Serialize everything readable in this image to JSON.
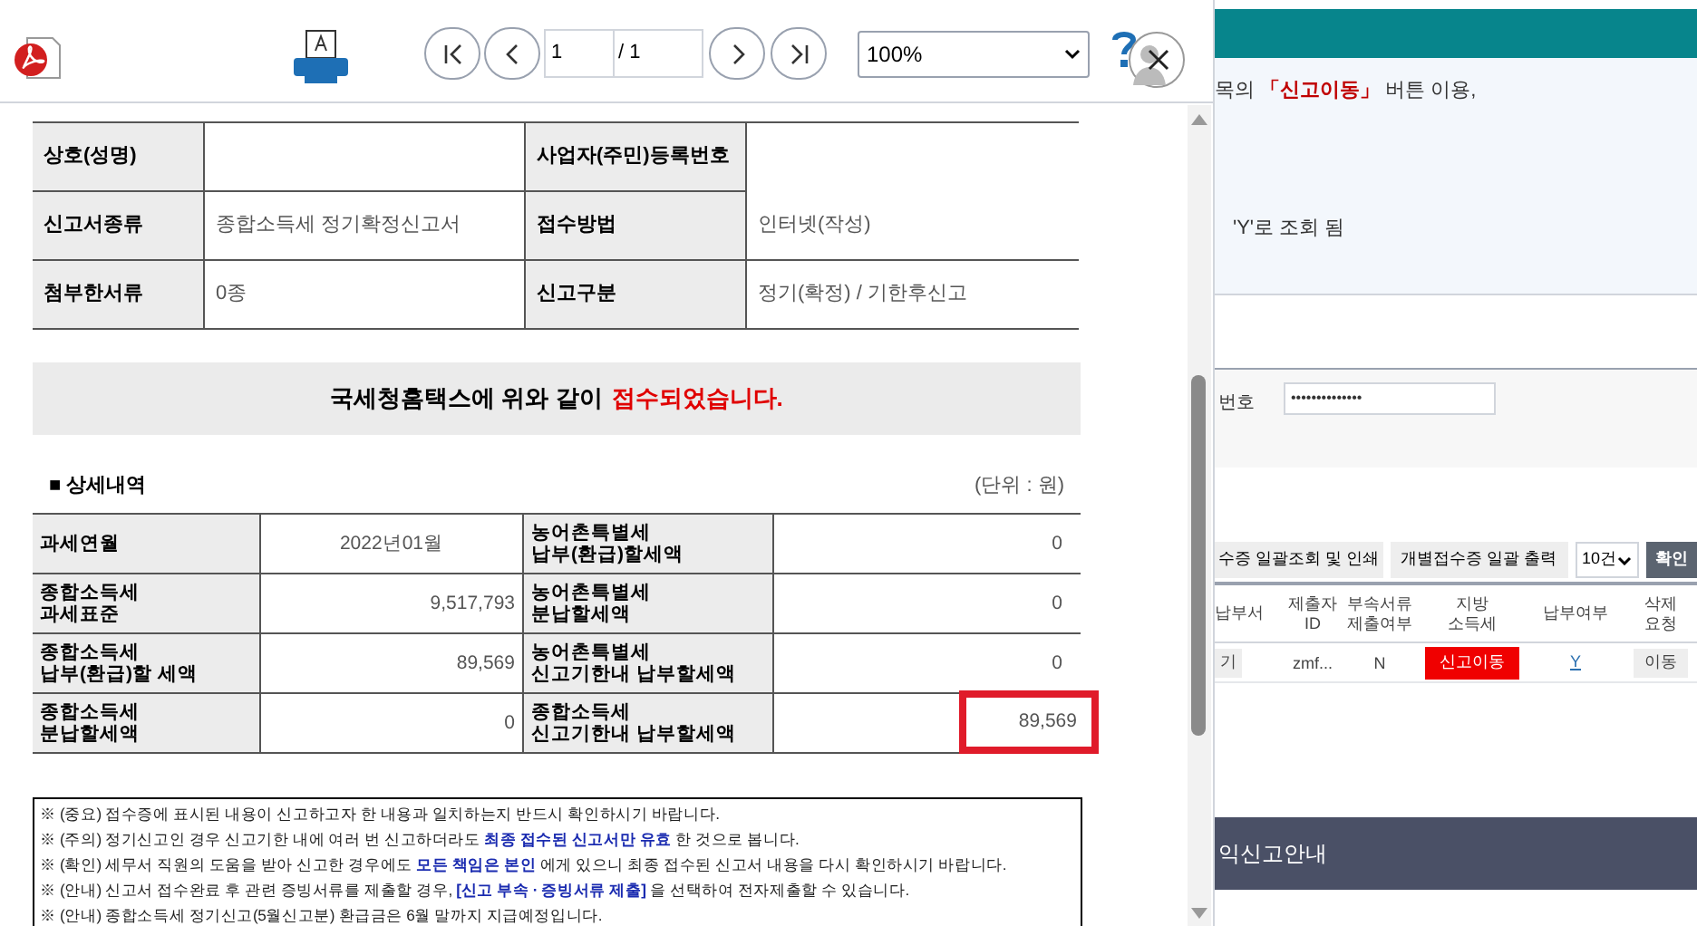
{
  "viewer": {
    "page": "1",
    "total": "/ 1",
    "zoom": "100%"
  },
  "summary": [
    {
      "label": "상호(성명)",
      "label2": "사업자(주민)등록번호"
    },
    {
      "label": "신고서종류",
      "value": "종합소득세 정기확정신고서",
      "label2": "접수방법",
      "value2": "인터넷(작성)"
    },
    {
      "label": "첨부한서류",
      "value": "0종",
      "label2": "신고구분",
      "value2": "정기(확정) / 기한후신고"
    }
  ],
  "banner": {
    "text": "국세청홈택스에 위와 같이",
    "highlight": "접수되었습니다."
  },
  "detail": {
    "title": "■ 상세내역",
    "unit": "(단위 : 원)",
    "rows": [
      {
        "label": "과세연월",
        "value": "2022년01월",
        "label2": "농어촌특별세\n납부(환급)할세액",
        "value2": "0",
        "highlighted": false
      },
      {
        "label": "종합소득세\n과세표준",
        "value": "9,517,793",
        "label2": "농어촌특별세\n분납할세액",
        "value2": "0",
        "highlighted": false
      },
      {
        "label": "종합소득세\n납부(환급)할 세액",
        "value": "89,569",
        "label2": "농어촌특별세\n신고기한내 납부할세액",
        "value2": "0",
        "highlighted": false
      },
      {
        "label": "종합소득세\n분납할세액",
        "value": "0",
        "label2": "종합소득세\n신고기한내 납부할세액",
        "value2": "89,569",
        "highlighted": true
      }
    ]
  },
  "notices": [
    "※ (중요) 접수증에 표시된 내용이 신고하고자 한 내용과 일치하는지 반드시 확인하시기 바랍니다.",
    "※ (주의) 정기신고인 경우 신고기한 내에 여러 번 신고하더라도  **최종 접수된 신고서만 유효** 한 것으로 봅니다.",
    "※ (확인) 세무서 직원의 도움을 받아 신고한 경우에도  **모든 책임은 본인** 에게 있으니 최종 접수된 신고서 내용을 다시 확인하시기 바랍니다.",
    "※ (안내) 신고서 접수완료 후 관련 증빙서류를 제출할 경우,  **[신고 부속 · 증빙서류 제출]** 을 선택하여 전자제출할 수 있습니다.",
    "※ (안내) 종합소득세 정기신고(5월신고분) 환급금은 6월 말까지 지급예정입니다."
  ],
  "background": {
    "info": [
      "목의 **「신고이동」** 버튼 이용,",
      "'Y'로 조회 됨"
    ],
    "field_label": "번호",
    "password": "••••••••••••••",
    "buttons": [
      "수증 일괄조회 및 인쇄",
      "개별접수증 일괄 출력"
    ],
    "page_size": "10건",
    "confirm": "확인",
    "columns": [
      "납부서",
      "제출자\nID",
      "부속서류\n제출여부",
      "지방\n소득세",
      "납부여부",
      "삭제\n요청"
    ],
    "row": {
      "view": "기",
      "id": "zmf...",
      "attached": "N",
      "local_tax": "신고이동",
      "paid": "Y",
      "delete": "이동"
    },
    "footer": "익신고안내"
  }
}
